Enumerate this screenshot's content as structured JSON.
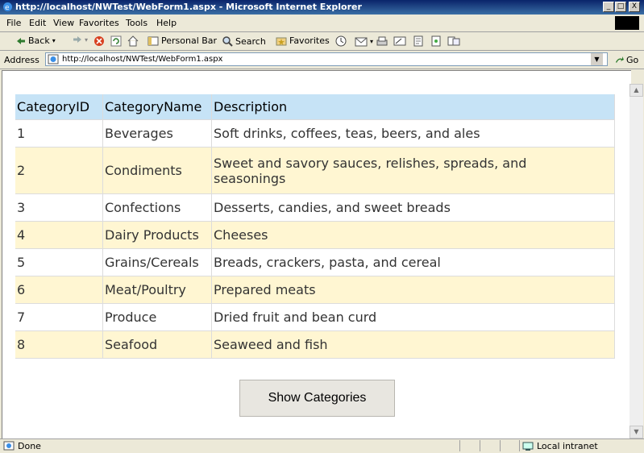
{
  "window": {
    "title": "http://localhost/NWTest/WebForm1.aspx - Microsoft Internet Explorer",
    "min": "_",
    "max": "□",
    "close": "X"
  },
  "menu": [
    {
      "label": "File"
    },
    {
      "label": "Edit"
    },
    {
      "label": "View"
    },
    {
      "label": "Favorites"
    },
    {
      "label": "Tools"
    },
    {
      "label": "Help"
    }
  ],
  "toolbar": {
    "back": "Back",
    "personal_bar": "Personal Bar",
    "search": "Search",
    "favorites": "Favorites"
  },
  "address": {
    "label": "Address",
    "url": "http://localhost/NWTest/WebForm1.aspx",
    "go": "Go"
  },
  "grid": {
    "headers": [
      "CategoryID",
      "CategoryName",
      "Description"
    ],
    "rows": [
      {
        "id": "1",
        "name": "Beverages",
        "desc": "Soft drinks, coffees, teas, beers, and ales"
      },
      {
        "id": "2",
        "name": "Condiments",
        "desc": "Sweet and savory sauces, relishes, spreads, and seasonings"
      },
      {
        "id": "3",
        "name": "Confections",
        "desc": "Desserts, candies, and sweet breads"
      },
      {
        "id": "4",
        "name": "Dairy Products",
        "desc": "Cheeses"
      },
      {
        "id": "5",
        "name": "Grains/Cereals",
        "desc": "Breads, crackers, pasta, and cereal"
      },
      {
        "id": "6",
        "name": "Meat/Poultry",
        "desc": "Prepared meats"
      },
      {
        "id": "7",
        "name": "Produce",
        "desc": "Dried fruit and bean curd"
      },
      {
        "id": "8",
        "name": "Seafood",
        "desc": "Seaweed and fish"
      }
    ]
  },
  "button": {
    "label": "Show Categories"
  },
  "status": {
    "text": "Done",
    "zone": "Local intranet"
  },
  "colors": {
    "header_bg": "#c6e3f6",
    "alt_row_bg": "#fff6d2",
    "title_bar": "#0a246a"
  }
}
